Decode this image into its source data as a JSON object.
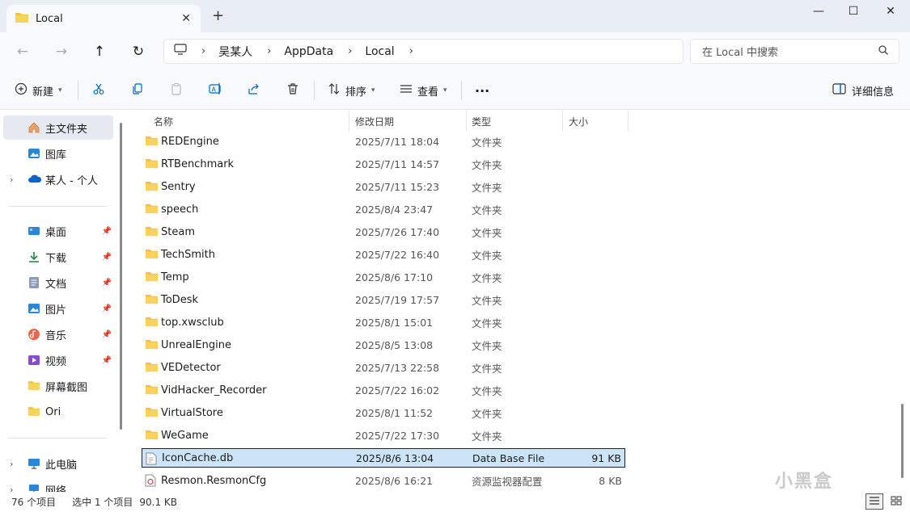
{
  "window": {
    "tab_title": "Local",
    "new_tab": "+",
    "close_tab": "✕",
    "minimize": "—",
    "maximize": "☐",
    "close": "✕"
  },
  "nav": {
    "breadcrumbs": [
      "吴某人",
      "AppData",
      "Local"
    ],
    "search_placeholder": "在 Local 中搜索"
  },
  "toolbar": {
    "new_label": "新建",
    "sort_label": "排序",
    "view_label": "查看",
    "more_label": "···",
    "details_label": "详细信息"
  },
  "sidebar": {
    "home": "主文件夹",
    "gallery": "图库",
    "onedrive": "某人 - 个人",
    "desktop": "桌面",
    "downloads": "下载",
    "documents": "文档",
    "pictures": "图片",
    "music": "音乐",
    "videos": "视频",
    "screenshots": "屏幕截图",
    "ori": "Ori",
    "thispc": "此电脑",
    "network": "网络"
  },
  "columns": {
    "name": "名称",
    "date": "修改日期",
    "type": "类型",
    "size": "大小"
  },
  "files": [
    {
      "name": "REDEngine",
      "date": "2025/7/11 18:04",
      "type": "文件夹",
      "size": ""
    },
    {
      "name": "RTBenchmark",
      "date": "2025/7/11 14:57",
      "type": "文件夹",
      "size": ""
    },
    {
      "name": "Sentry",
      "date": "2025/7/11 15:23",
      "type": "文件夹",
      "size": ""
    },
    {
      "name": "speech",
      "date": "2025/8/4 23:47",
      "type": "文件夹",
      "size": ""
    },
    {
      "name": "Steam",
      "date": "2025/7/26 17:40",
      "type": "文件夹",
      "size": ""
    },
    {
      "name": "TechSmith",
      "date": "2025/7/22 16:40",
      "type": "文件夹",
      "size": ""
    },
    {
      "name": "Temp",
      "date": "2025/8/6 17:10",
      "type": "文件夹",
      "size": ""
    },
    {
      "name": "ToDesk",
      "date": "2025/7/19 17:57",
      "type": "文件夹",
      "size": ""
    },
    {
      "name": "top.xwsclub",
      "date": "2025/8/1 15:01",
      "type": "文件夹",
      "size": ""
    },
    {
      "name": "UnrealEngine",
      "date": "2025/8/5 13:08",
      "type": "文件夹",
      "size": ""
    },
    {
      "name": "VEDetector",
      "date": "2025/7/13 22:58",
      "type": "文件夹",
      "size": ""
    },
    {
      "name": "VidHacker_Recorder",
      "date": "2025/7/22 16:02",
      "type": "文件夹",
      "size": ""
    },
    {
      "name": "VirtualStore",
      "date": "2025/8/1 11:52",
      "type": "文件夹",
      "size": ""
    },
    {
      "name": "WeGame",
      "date": "2025/7/22 17:30",
      "type": "文件夹",
      "size": ""
    },
    {
      "name": "IconCache.db",
      "date": "2025/8/6 13:04",
      "type": "Data Base File",
      "size": "91 KB"
    },
    {
      "name": "Resmon.ResmonCfg",
      "date": "2025/8/6 16:21",
      "type": "资源监视器配置",
      "size": "8 KB"
    }
  ],
  "status": {
    "count": "76 个项目",
    "selection": "选中 1 个项目",
    "size": "90.1 KB"
  },
  "watermark": "小黑盒",
  "colors": {
    "folder": "#f3c443",
    "selected_row": "#cce4f7",
    "accent": "#0067c0"
  }
}
